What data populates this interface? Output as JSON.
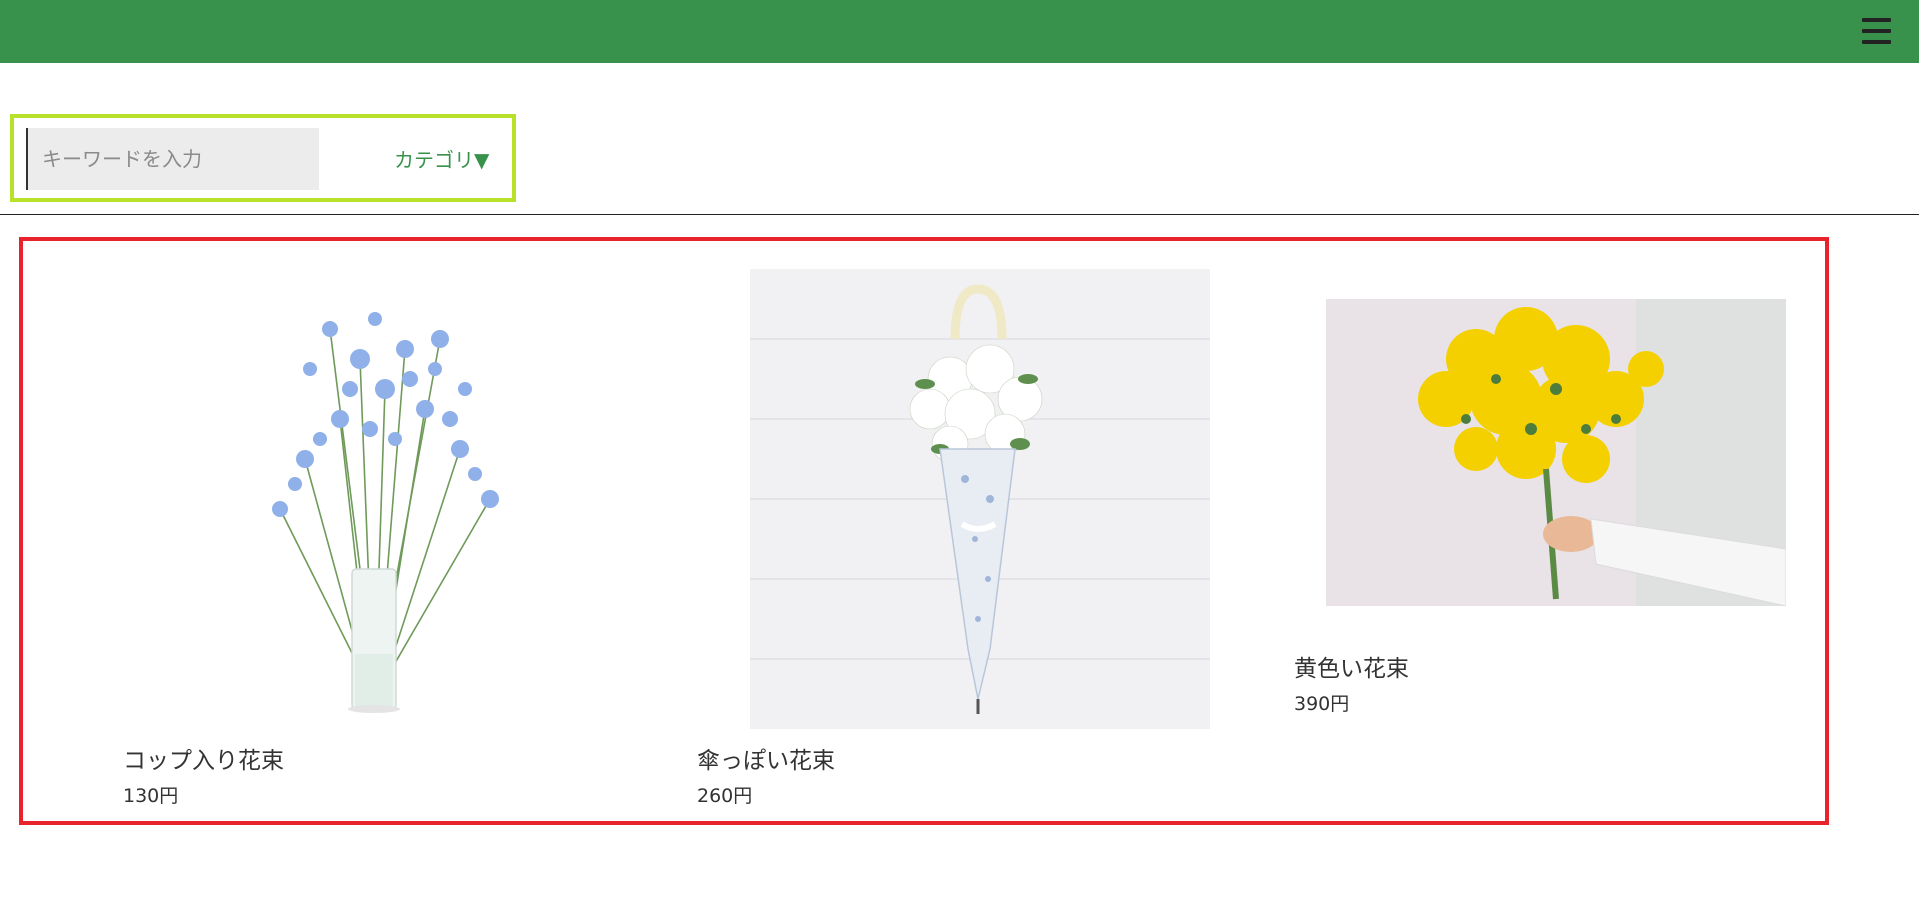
{
  "header": {
    "menu_icon": "hamburger-menu-icon",
    "color": "#38924b"
  },
  "search": {
    "placeholder": "キーワードを入力",
    "category_label": "カテゴリ▼",
    "border_color": "#b8e22a"
  },
  "products": {
    "border_color": "#e8232c",
    "items": [
      {
        "name": "コップ入り花束",
        "price": "130円",
        "image": "blue-flowers-in-glass-vase"
      },
      {
        "name": "傘っぽい花束",
        "price": "260円",
        "image": "white-bouquet-umbrella"
      },
      {
        "name": "黄色い花束",
        "price": "390円",
        "image": "yellow-mimosa-bouquet"
      }
    ]
  }
}
